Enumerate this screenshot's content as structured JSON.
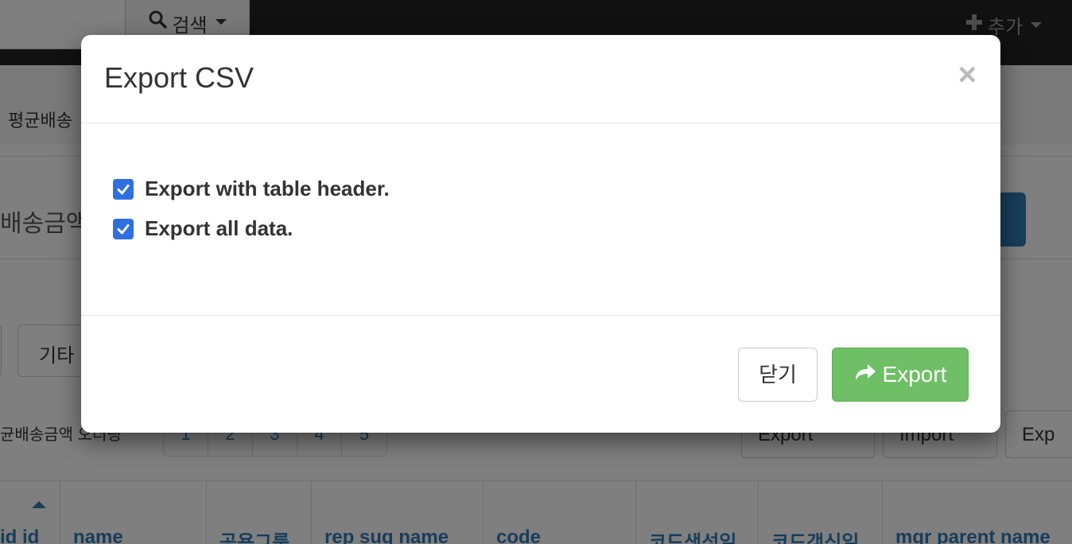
{
  "navbar": {
    "search_label": "검색",
    "add_label": "추가"
  },
  "background": {
    "section_label": "평균배송",
    "filter_label": "배송금액",
    "tab_other": "기타",
    "pager_label": "균배송금액 오더링",
    "pager_pages": [
      "1",
      "2",
      "3",
      "4",
      "5"
    ],
    "toolbar": {
      "export_label": "Export",
      "import_label": "Import",
      "export2_label": "Exp"
    },
    "table_headers": [
      "id id",
      "name",
      "공용그룹",
      "rep sug name",
      "code",
      "코드생성일",
      "코드갱신일",
      "mgr parent name"
    ]
  },
  "modal": {
    "title": "Export CSV",
    "close_glyph": "×",
    "options": [
      {
        "label": "Export with table header.",
        "checked": true
      },
      {
        "label": "Export all data.",
        "checked": true
      }
    ],
    "footer": {
      "close_label": "닫기",
      "export_label": "Export"
    }
  },
  "colors": {
    "navbar": "#222222",
    "checkbox": "#2f6fe0",
    "export_button": "#6fbf66",
    "link": "#337ab7"
  }
}
